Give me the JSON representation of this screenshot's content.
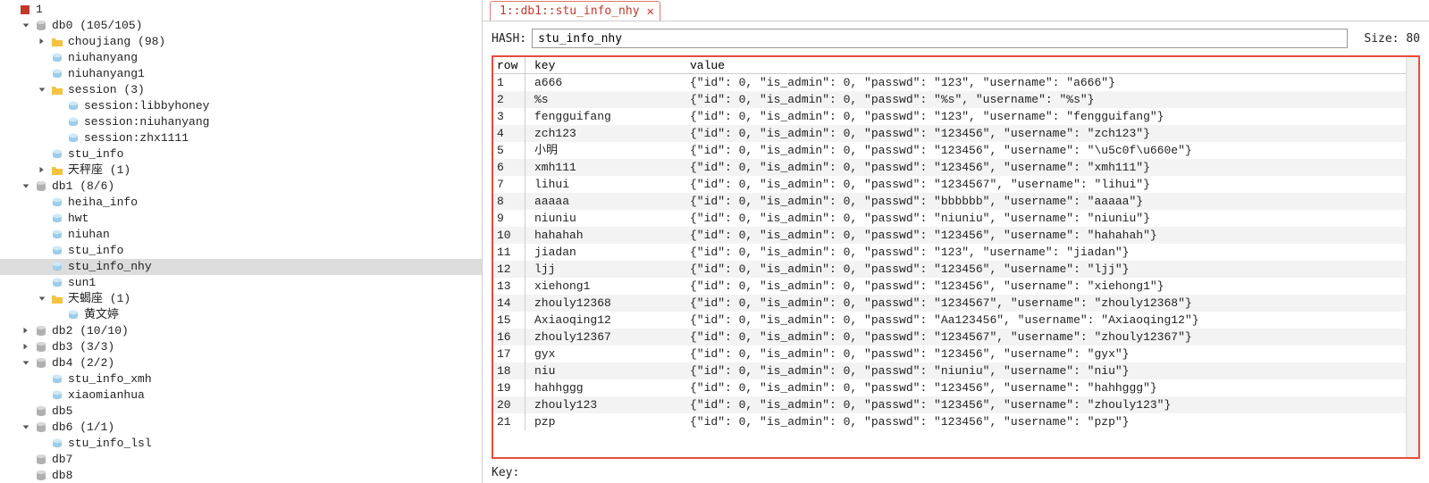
{
  "tree": [
    {
      "indent": 0,
      "toggle": "none",
      "icon": "cube",
      "label": "1"
    },
    {
      "indent": 1,
      "toggle": "open",
      "icon": "db",
      "label": "db0  (105/105)"
    },
    {
      "indent": 2,
      "toggle": "closed",
      "icon": "folder",
      "label": "choujiang  (98)"
    },
    {
      "indent": 2,
      "toggle": "none",
      "icon": "key",
      "label": "niuhanyang"
    },
    {
      "indent": 2,
      "toggle": "none",
      "icon": "key",
      "label": "niuhanyang1"
    },
    {
      "indent": 2,
      "toggle": "open",
      "icon": "folder",
      "label": "session  (3)"
    },
    {
      "indent": 3,
      "toggle": "none",
      "icon": "key",
      "label": "session:libbyhoney"
    },
    {
      "indent": 3,
      "toggle": "none",
      "icon": "key",
      "label": "session:niuhanyang"
    },
    {
      "indent": 3,
      "toggle": "none",
      "icon": "key",
      "label": "session:zhx1111"
    },
    {
      "indent": 2,
      "toggle": "none",
      "icon": "key",
      "label": "stu_info"
    },
    {
      "indent": 2,
      "toggle": "closed",
      "icon": "folder",
      "label": "天秤座  (1)"
    },
    {
      "indent": 1,
      "toggle": "open",
      "icon": "db",
      "label": "db1  (8/6)"
    },
    {
      "indent": 2,
      "toggle": "none",
      "icon": "key",
      "label": "heiha_info"
    },
    {
      "indent": 2,
      "toggle": "none",
      "icon": "key",
      "label": "hwt"
    },
    {
      "indent": 2,
      "toggle": "none",
      "icon": "key",
      "label": "niuhan"
    },
    {
      "indent": 2,
      "toggle": "none",
      "icon": "key",
      "label": "stu_info"
    },
    {
      "indent": 2,
      "toggle": "none",
      "icon": "key",
      "label": "stu_info_nhy",
      "selected": true
    },
    {
      "indent": 2,
      "toggle": "none",
      "icon": "key",
      "label": "sun1"
    },
    {
      "indent": 2,
      "toggle": "open",
      "icon": "folder",
      "label": "天蝎座  (1)"
    },
    {
      "indent": 3,
      "toggle": "none",
      "icon": "key",
      "label": "黄文婷"
    },
    {
      "indent": 1,
      "toggle": "closed",
      "icon": "db",
      "label": "db2  (10/10)"
    },
    {
      "indent": 1,
      "toggle": "closed",
      "icon": "db",
      "label": "db3  (3/3)"
    },
    {
      "indent": 1,
      "toggle": "open",
      "icon": "db",
      "label": "db4  (2/2)"
    },
    {
      "indent": 2,
      "toggle": "none",
      "icon": "key",
      "label": "stu_info_xmh"
    },
    {
      "indent": 2,
      "toggle": "none",
      "icon": "key",
      "label": "xiaomianhua"
    },
    {
      "indent": 1,
      "toggle": "none",
      "icon": "db",
      "label": "db5"
    },
    {
      "indent": 1,
      "toggle": "open",
      "icon": "db",
      "label": "db6  (1/1)"
    },
    {
      "indent": 2,
      "toggle": "none",
      "icon": "key",
      "label": "stu_info_lsl"
    },
    {
      "indent": 1,
      "toggle": "none",
      "icon": "db",
      "label": "db7"
    },
    {
      "indent": 1,
      "toggle": "none",
      "icon": "db",
      "label": "db8"
    }
  ],
  "tab": {
    "title": "1::db1::stu_info_nhy",
    "close_glyph": "✕"
  },
  "hash": {
    "label": "HASH:",
    "value": "stu_info_nhy",
    "size_label": "Size: 80"
  },
  "headers": {
    "row": "row",
    "key": "key",
    "value": "value"
  },
  "rows": [
    {
      "n": "1",
      "key": "a666",
      "val": "{\"id\": 0, \"is_admin\": 0, \"passwd\": \"123\", \"username\": \"a666\"}"
    },
    {
      "n": "2",
      "key": "%s",
      "val": "{\"id\": 0, \"is_admin\": 0, \"passwd\": \"%s\", \"username\": \"%s\"}"
    },
    {
      "n": "3",
      "key": "fengguifang",
      "val": "{\"id\": 0, \"is_admin\": 0, \"passwd\": \"123\", \"username\": \"fengguifang\"}"
    },
    {
      "n": "4",
      "key": "zch123",
      "val": "{\"id\": 0, \"is_admin\": 0, \"passwd\": \"123456\", \"username\": \"zch123\"}"
    },
    {
      "n": "5",
      "key": "小明",
      "val": "{\"id\": 0, \"is_admin\": 0, \"passwd\": \"123456\", \"username\": \"\\u5c0f\\u660e\"}"
    },
    {
      "n": "6",
      "key": "xmh111",
      "val": "{\"id\": 0, \"is_admin\": 0, \"passwd\": \"123456\", \"username\": \"xmh111\"}"
    },
    {
      "n": "7",
      "key": "lihui",
      "val": "{\"id\": 0, \"is_admin\": 0, \"passwd\": \"1234567\", \"username\": \"lihui\"}"
    },
    {
      "n": "8",
      "key": "aaaaa",
      "val": "{\"id\": 0, \"is_admin\": 0, \"passwd\": \"bbbbbb\", \"username\": \"aaaaa\"}"
    },
    {
      "n": "9",
      "key": "niuniu",
      "val": "{\"id\": 0, \"is_admin\": 0, \"passwd\": \"niuniu\", \"username\": \"niuniu\"}"
    },
    {
      "n": "10",
      "key": "hahahah",
      "val": "{\"id\": 0, \"is_admin\": 0, \"passwd\": \"123456\", \"username\": \"hahahah\"}"
    },
    {
      "n": "11",
      "key": "jiadan",
      "val": "{\"id\": 0, \"is_admin\": 0, \"passwd\": \"123\", \"username\": \"jiadan\"}"
    },
    {
      "n": "12",
      "key": "ljj",
      "val": "{\"id\": 0, \"is_admin\": 0, \"passwd\": \"123456\", \"username\": \"ljj\"}"
    },
    {
      "n": "13",
      "key": "xiehong1",
      "val": "{\"id\": 0, \"is_admin\": 0, \"passwd\": \"123456\", \"username\": \"xiehong1\"}"
    },
    {
      "n": "14",
      "key": "zhouly12368",
      "val": "{\"id\": 0, \"is_admin\": 0, \"passwd\": \"1234567\", \"username\": \"zhouly12368\"}"
    },
    {
      "n": "15",
      "key": "Axiaoqing12",
      "val": "{\"id\": 0, \"is_admin\": 0, \"passwd\": \"Aa123456\", \"username\": \"Axiaoqing12\"}"
    },
    {
      "n": "16",
      "key": "zhouly12367",
      "val": "{\"id\": 0, \"is_admin\": 0, \"passwd\": \"1234567\", \"username\": \"zhouly12367\"}"
    },
    {
      "n": "17",
      "key": "gyx",
      "val": "{\"id\": 0, \"is_admin\": 0, \"passwd\": \"123456\", \"username\": \"gyx\"}"
    },
    {
      "n": "18",
      "key": "niu",
      "val": "{\"id\": 0, \"is_admin\": 0, \"passwd\": \"niuniu\", \"username\": \"niu\"}"
    },
    {
      "n": "19",
      "key": "hahhggg",
      "val": "{\"id\": 0, \"is_admin\": 0, \"passwd\": \"123456\", \"username\": \"hahhggg\"}"
    },
    {
      "n": "20",
      "key": "zhouly123",
      "val": "{\"id\": 0, \"is_admin\": 0, \"passwd\": \"123456\", \"username\": \"zhouly123\"}"
    },
    {
      "n": "21",
      "key": "pzp",
      "val": "{\"id\": 0, \"is_admin\": 0, \"passwd\": \"123456\", \"username\": \"pzp\"}"
    }
  ],
  "bottom": {
    "key_label": "Key:"
  },
  "colors": {
    "highlight_border": "#e74c3c",
    "tab_text": "#c0392b",
    "selected_bg": "#dcdcdc"
  }
}
